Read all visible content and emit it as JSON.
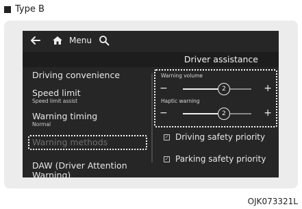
{
  "caption": "Type B",
  "topbar": {
    "back_icon": "back-arrow-icon",
    "home_icon": "home-icon",
    "menu_label": "Menu",
    "search_icon": "search-icon"
  },
  "header": {
    "title": "Driver assistance"
  },
  "sidebar": {
    "items": [
      {
        "label": "Driving convenience",
        "sub": ""
      },
      {
        "label": "Speed limit",
        "sub": "Speed limit assist"
      },
      {
        "label": "Warning timing",
        "sub": "Normal"
      },
      {
        "label": "Warning methods",
        "sub": "",
        "selected": true
      },
      {
        "label": "DAW (Driver Attention Warning)",
        "sub": ""
      }
    ]
  },
  "controls": {
    "warning_volume": {
      "label": "Warning volume",
      "value": "2",
      "level": 0.6
    },
    "haptic_warning": {
      "label": "Haptic warning",
      "value": "2",
      "level": 0.6
    },
    "minus_symbol": "−",
    "plus_symbol": "+"
  },
  "options": [
    {
      "label": "Driving safety priority",
      "checked": true
    },
    {
      "label": "Parking safety priority",
      "checked": true
    }
  ],
  "reference_code": "OJK073321L"
}
